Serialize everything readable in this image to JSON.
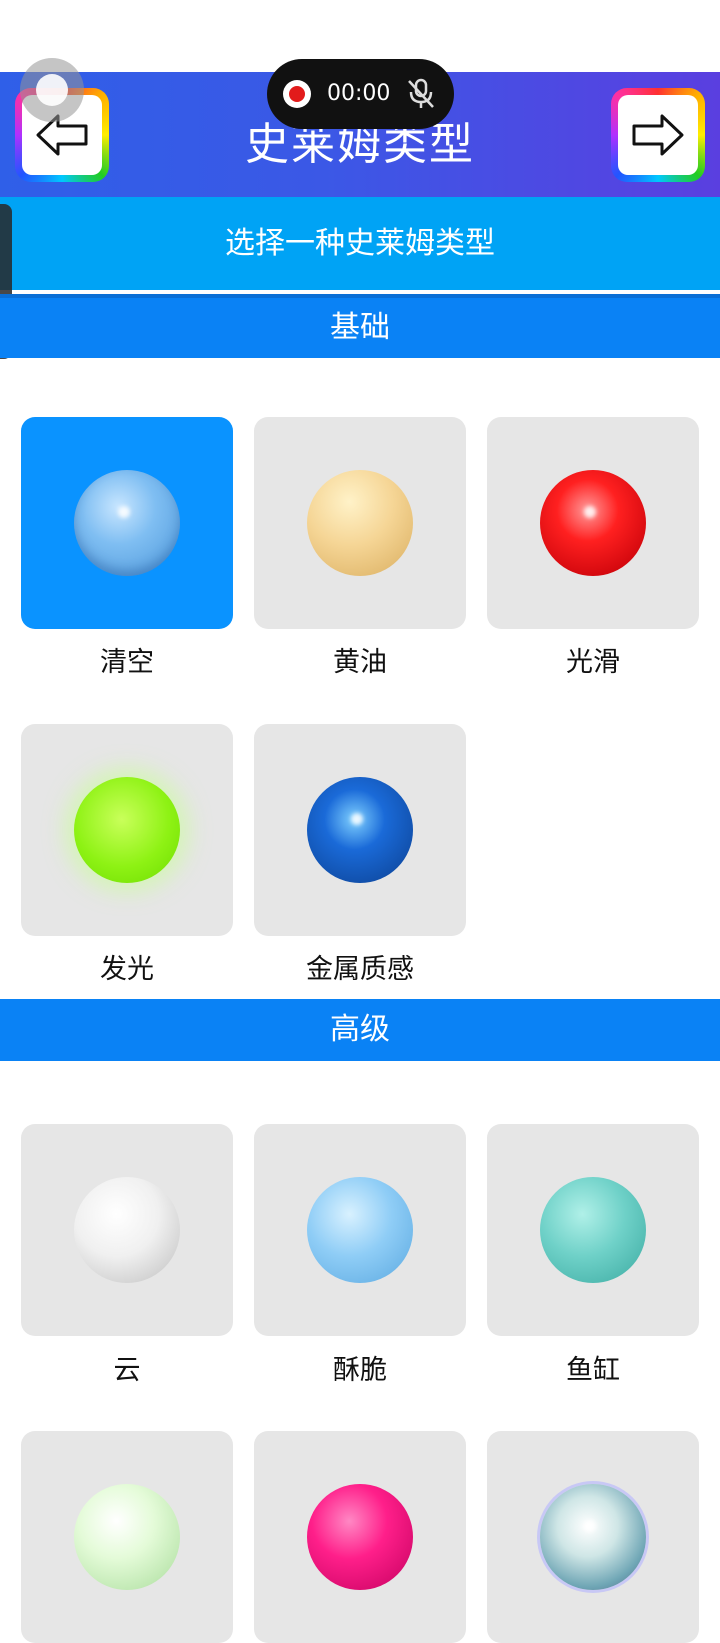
{
  "app": {
    "title": "史莱姆类型"
  },
  "recording": {
    "time": "00:00"
  },
  "subtitle": "选择一种史莱姆类型",
  "sections": {
    "basic": {
      "label": "基础"
    },
    "advanced": {
      "label": "高级"
    }
  },
  "basic_items": [
    {
      "label": "清空",
      "sphere": "clear-sphere-icon",
      "selected": true
    },
    {
      "label": "黄油",
      "sphere": "butter-sphere-icon"
    },
    {
      "label": "光滑",
      "sphere": "glossy-sphere-icon"
    },
    {
      "label": "发光",
      "sphere": "glow-sphere-icon"
    },
    {
      "label": "金属质感",
      "sphere": "metal-sphere-icon"
    }
  ],
  "advanced_items": [
    {
      "label": "云",
      "sphere": "cloud-sphere-icon"
    },
    {
      "label": "酥脆",
      "sphere": "crunchy-sphere-icon"
    },
    {
      "label": "鱼缸",
      "sphere": "aquarium-sphere-icon"
    },
    {
      "sphere": "mint-sphere-icon"
    },
    {
      "sphere": "glitter-sphere-icon"
    },
    {
      "sphere": "bubble-sphere-icon"
    }
  ],
  "colors": {
    "header_gradient": [
      "#2f5fe8",
      "#5a3fe0"
    ],
    "subtitle_bar": "#00a3f5",
    "section_bar": "#0a82f5",
    "selected_tile": "#0a93ff"
  }
}
